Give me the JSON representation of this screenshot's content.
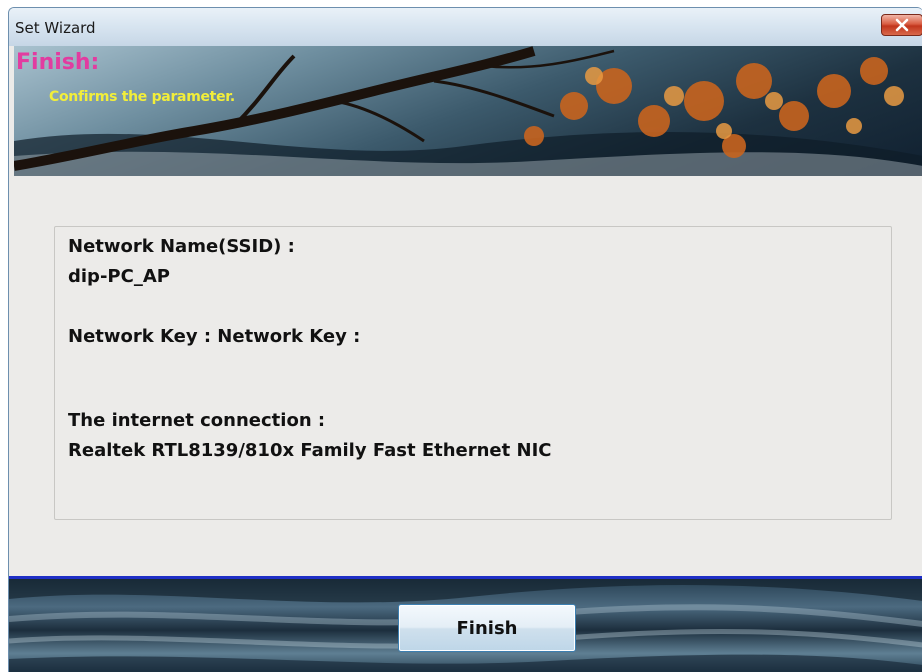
{
  "window": {
    "title": "Set Wizard"
  },
  "banner": {
    "title": "Finish:",
    "subtitle": "Confirms the parameter."
  },
  "info": {
    "ssid_label": "Network Name(SSID) :",
    "ssid_value": "dip-PC_AP",
    "key_label": "Network Key : Network Key :",
    "connection_label": "The internet connection :",
    "connection_value": "Realtek RTL8139/810x Family Fast Ethernet NIC"
  },
  "footer": {
    "finish_label": "Finish"
  },
  "colors": {
    "title_accent": "#e23ca0",
    "subtitle_accent": "#f2ee3a",
    "footer_rule": "#1f2fc6"
  },
  "icons": {
    "close": "close-icon"
  }
}
